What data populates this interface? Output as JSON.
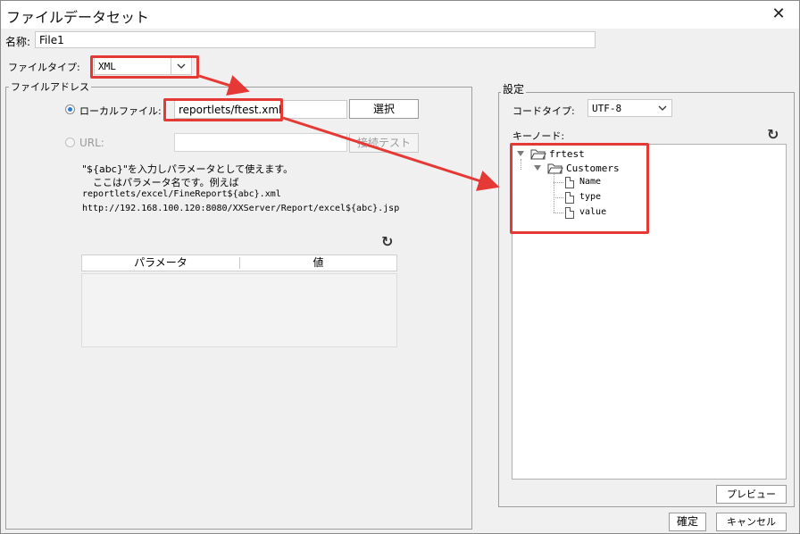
{
  "dialog": {
    "title": "ファイルデータセット",
    "close_glyph": "✕",
    "close_icon": "close-icon"
  },
  "name_row": {
    "label": "名称:",
    "value": "File1"
  },
  "file_type": {
    "label": "ファイルタイプ:",
    "value": "XML",
    "arrow_icon": "chevron-down-icon"
  },
  "file_address": {
    "legend": "ファイルアドレス",
    "local": {
      "label": "ローカルファイル:",
      "value": "reportlets/ftest.xml",
      "select_button": "選択",
      "selected": true
    },
    "url": {
      "label": "URL:",
      "value": "",
      "test_button": "接続テスト",
      "selected": false
    },
    "hint_line1": "\"${abc}\"を入力しパラメータとして使えます。",
    "hint_line2": "ここはパラメータ名です。例えば",
    "hint_line3": "reportlets/excel/FineReport${abc}.xml",
    "hint_line4": "http://192.168.100.120:8080/XXServer/Report/excel${abc}.jsp",
    "refresh_icon": "refresh-icon",
    "refresh_glyph": "↻",
    "param_table": {
      "columns": [
        "パラメータ",
        "値"
      ],
      "rows": []
    }
  },
  "settings": {
    "legend": "設定",
    "code_type": {
      "label": "コードタイプ:",
      "value": "UTF-8",
      "arrow_icon": "chevron-down-icon"
    },
    "key_node": {
      "label": "キーノード:",
      "refresh_glyph": "↻",
      "refresh_icon": "refresh-icon"
    },
    "tree": {
      "root": "frtest",
      "child": "Customers",
      "leaves": [
        "Name",
        "type",
        "value"
      ]
    },
    "preview_button": "プレビュー"
  },
  "footer": {
    "ok_button": "確定",
    "cancel_button": "キャンセル"
  },
  "colors": {
    "annotation_red": "#e53935",
    "radio_blue": "#2b7bd4"
  }
}
